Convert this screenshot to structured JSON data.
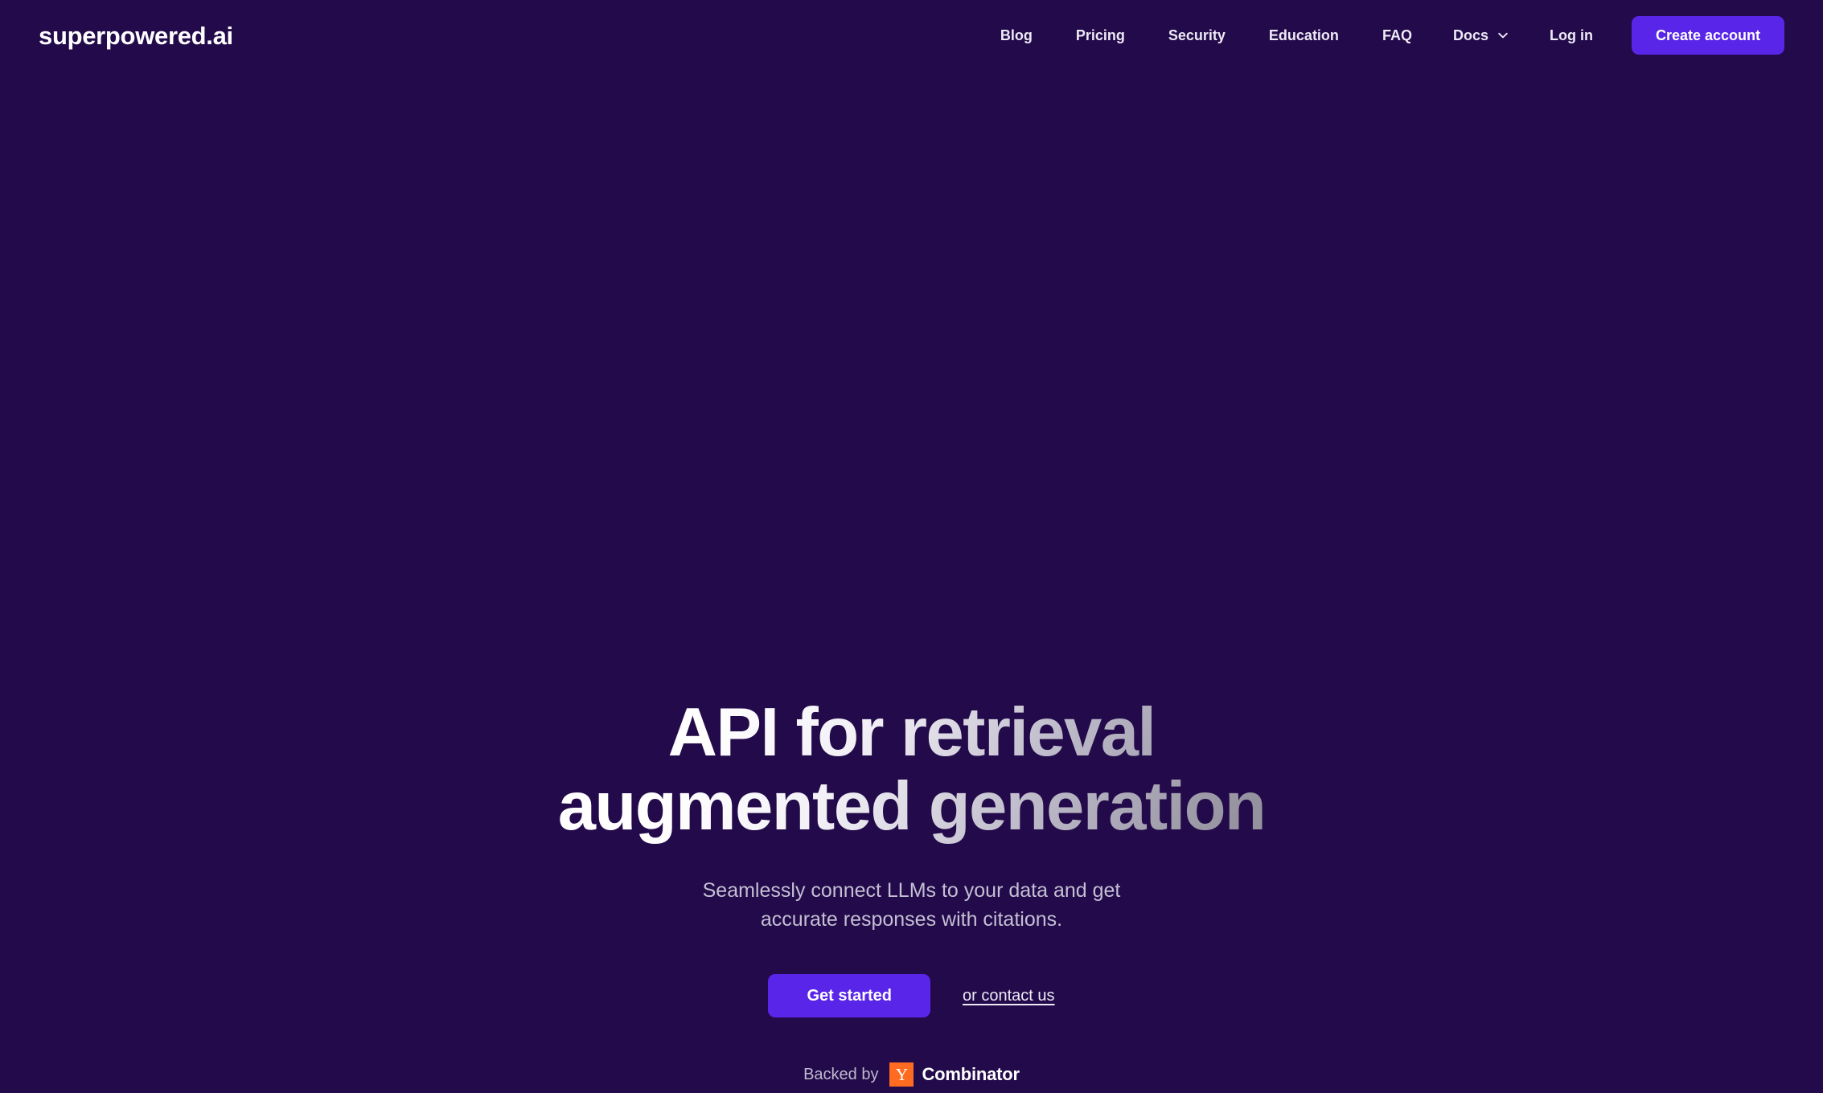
{
  "theme": {
    "background": "#230A4A",
    "accent_purple": "#5925E8",
    "yc_orange": "#FF6B21",
    "nav_text": "#EDE9F6",
    "body_text": "#C4BFD4"
  },
  "header": {
    "brand": "superpowered.ai",
    "nav_items": [
      {
        "label": "Blog"
      },
      {
        "label": "Pricing"
      },
      {
        "label": "Security"
      },
      {
        "label": "Education"
      },
      {
        "label": "FAQ"
      }
    ],
    "docs_dropdown": {
      "label": "Docs",
      "icon": "chevron-down-icon"
    },
    "login_label": "Log in",
    "create_account_label": "Create account"
  },
  "hero": {
    "title": "API for retrieval augmented generation",
    "subtitle": "Seamlessly connect LLMs to your data and get accurate responses with citations.",
    "primary_cta": "Get started",
    "secondary_cta": "or contact us",
    "backed_by": {
      "prefix": "Backed by",
      "mark": "Y",
      "name": "Combinator"
    }
  }
}
